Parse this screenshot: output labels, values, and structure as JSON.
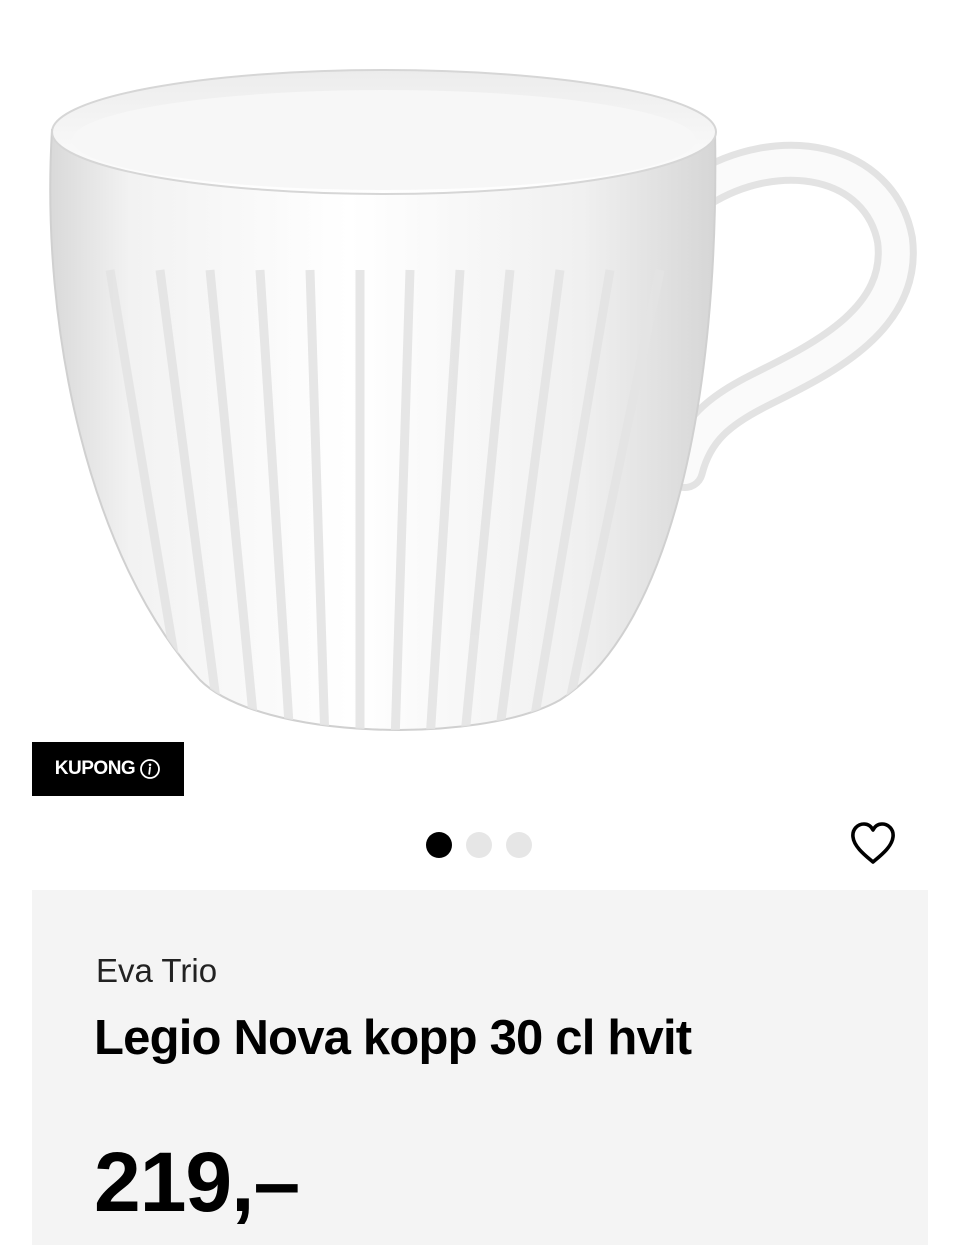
{
  "product": {
    "image_icon": "cup-image",
    "coupon_label": "KUPONG",
    "coupon_icon": "info-icon",
    "gallery": {
      "count": 3,
      "active_index": 0
    },
    "wishlist_icon": "heart-icon",
    "brand": "Eva Trio",
    "title": "Legio Nova kopp 30 cl hvit",
    "price": "219,–"
  },
  "colors": {
    "badge_bg": "#000000",
    "panel_bg": "#f4f4f4",
    "dot_active": "#000000",
    "dot_inactive": "#e6e6e6"
  }
}
